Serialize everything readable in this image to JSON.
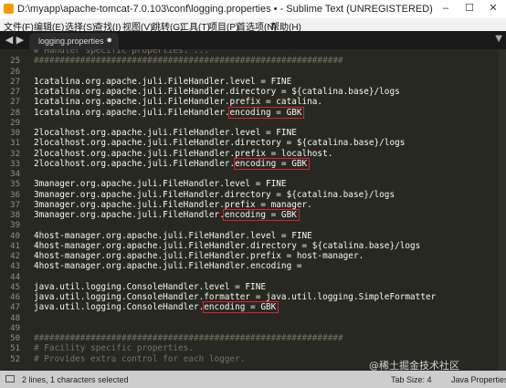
{
  "window": {
    "title": "D:\\myapp\\apache-tomcat-7.0.103\\conf\\logging.properties • - Sublime Text (UNREGISTERED)",
    "icon": "sublime-text-icon"
  },
  "menu": [
    "文件(F)",
    "编辑(E)",
    "选择(S)",
    "查找(I)",
    "视图(V)",
    "跳转(G)",
    "工具(T)",
    "项目(P)",
    "首选项(N)",
    "帮助(H)"
  ],
  "tab": {
    "label": "logging.properties"
  },
  "editor": {
    "lines": [
      {
        "num": "",
        "text": "# Handler specific properties. ..."
      },
      {
        "num": "25",
        "text": "############################################################"
      },
      {
        "num": "26",
        "text": ""
      },
      {
        "num": "27",
        "text": "1catalina.org.apache.juli.FileHandler.level = FINE"
      },
      {
        "num": "27",
        "text": "1catalina.org.apache.juli.FileHandler.directory = ${catalina.base}/logs"
      },
      {
        "num": "27",
        "text": "1catalina.org.apache.juli.FileHandler.prefix = catalina."
      },
      {
        "num": "28",
        "text": "1catalina.org.apache.juli.FileHandler.encoding = GBK"
      },
      {
        "num": "29",
        "text": ""
      },
      {
        "num": "30",
        "text": "2localhost.org.apache.juli.FileHandler.level = FINE"
      },
      {
        "num": "31",
        "text": "2localhost.org.apache.juli.FileHandler.directory = ${catalina.base}/logs"
      },
      {
        "num": "32",
        "text": "2localhost.org.apache.juli.FileHandler.prefix = localhost."
      },
      {
        "num": "33",
        "text": "2localhost.org.apache.juli.FileHandler.encoding = GBK"
      },
      {
        "num": "34",
        "text": ""
      },
      {
        "num": "35",
        "text": "3manager.org.apache.juli.FileHandler.level = FINE"
      },
      {
        "num": "36",
        "text": "3manager.org.apache.juli.FileHandler.directory = ${catalina.base}/logs"
      },
      {
        "num": "37",
        "text": "3manager.org.apache.juli.FileHandler.prefix = manager."
      },
      {
        "num": "38",
        "text": "3manager.org.apache.juli.FileHandler.encoding = GBK"
      },
      {
        "num": "39",
        "text": ""
      },
      {
        "num": "40",
        "text": "4host-manager.org.apache.juli.FileHandler.level = FINE"
      },
      {
        "num": "41",
        "text": "4host-manager.org.apache.juli.FileHandler.directory = ${catalina.base}/logs"
      },
      {
        "num": "42",
        "text": "4host-manager.org.apache.juli.FileHandler.prefix = host-manager."
      },
      {
        "num": "43",
        "text": "4host-manager.org.apache.juli.FileHandler.encoding ="
      },
      {
        "num": "44",
        "text": ""
      },
      {
        "num": "45",
        "text": "java.util.logging.ConsoleHandler.level = FINE"
      },
      {
        "num": "46",
        "text": "java.util.logging.ConsoleHandler.formatter = java.util.logging.SimpleFormatter"
      },
      {
        "num": "47",
        "text": "java.util.logging.ConsoleHandler.encoding = GBK"
      },
      {
        "num": "48",
        "text": ""
      },
      {
        "num": "49",
        "text": ""
      },
      {
        "num": "50",
        "text": "############################################################"
      },
      {
        "num": "51",
        "text": "# Facility specific properties."
      },
      {
        "num": "52",
        "text": "# Provides extra control for each logger."
      }
    ],
    "highlighted_text": "encoding = GBK"
  },
  "status": {
    "selection": "2 lines, 1 characters selected",
    "tab_size": "Tab Size: 4",
    "syntax": "Java Properties"
  },
  "watermark": "@稀土掘金技术社区",
  "colors": {
    "editor_bg": "#272822",
    "highlight_box": "#e0202a"
  }
}
